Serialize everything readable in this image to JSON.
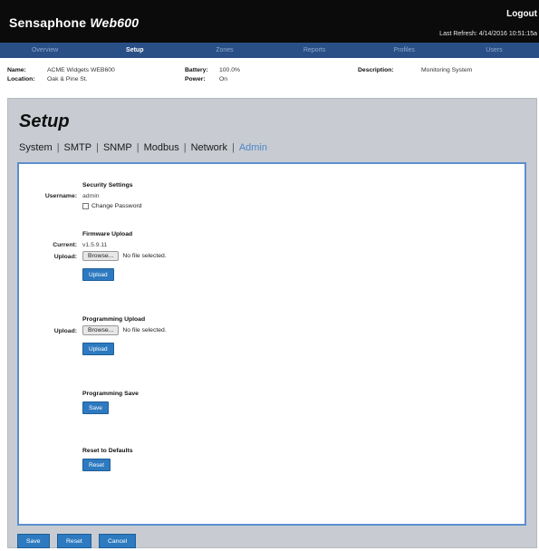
{
  "header": {
    "brand": "Sensaphone",
    "model": "Web600",
    "logout_label": "Logout",
    "last_refresh_label": "Last Refresh:",
    "last_refresh_value": "4/14/2016 10:51:15a"
  },
  "nav": {
    "items": [
      {
        "label": "Overview"
      },
      {
        "label": "Setup",
        "active": true
      },
      {
        "label": "Zones"
      },
      {
        "label": "Reports"
      },
      {
        "label": "Profiles"
      },
      {
        "label": "Users"
      }
    ]
  },
  "info": {
    "name_label": "Name:",
    "name_value": "ACME Widgets WEB600",
    "location_label": "Location:",
    "location_value": "Oak & Pine St.",
    "battery_label": "Battery:",
    "battery_value": "100.0%",
    "power_label": "Power:",
    "power_value": "On",
    "description_label": "Description:",
    "description_value": "Monitoring System"
  },
  "page": {
    "title": "Setup",
    "subnav": [
      {
        "label": "System"
      },
      {
        "label": "SMTP"
      },
      {
        "label": "SNMP"
      },
      {
        "label": "Modbus"
      },
      {
        "label": "Network"
      },
      {
        "label": "Admin",
        "active": true
      }
    ]
  },
  "security": {
    "title": "Security Settings",
    "username_label": "Username:",
    "username_value": "admin",
    "change_password_label": "Change Password",
    "change_password_checked": false
  },
  "firmware": {
    "title": "Firmware Upload",
    "current_label": "Current:",
    "current_value": "v1.5.9.11",
    "upload_label": "Upload:",
    "browse_label": "Browse...",
    "no_file_text": "No file selected.",
    "upload_button": "Upload"
  },
  "programming_upload": {
    "title": "Programming Upload",
    "upload_label": "Upload:",
    "browse_label": "Browse...",
    "no_file_text": "No file selected.",
    "upload_button": "Upload"
  },
  "programming_save": {
    "title": "Programming Save",
    "save_button": "Save"
  },
  "reset": {
    "title": "Reset to Defaults",
    "reset_button": "Reset"
  },
  "footer": {
    "save_button": "Save",
    "reset_button": "Reset",
    "cancel_button": "Cancel"
  },
  "colors": {
    "header_bg": "#0b0b0b",
    "nav_bg": "#2a4f86",
    "panel_bg": "#c8ccd2",
    "accent": "#2d7ac0",
    "active_tab": "#4f86c6"
  }
}
